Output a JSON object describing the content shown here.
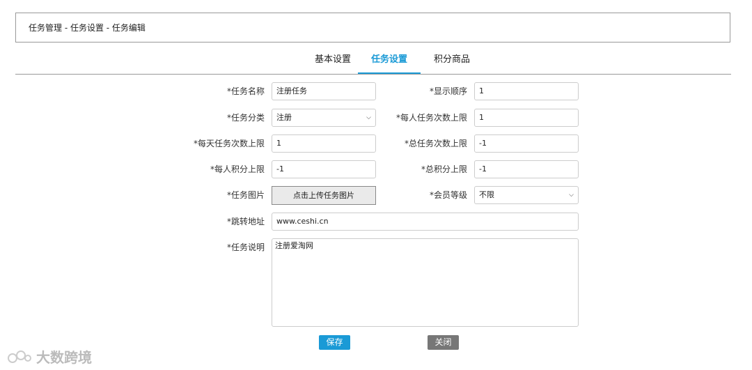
{
  "breadcrumb": "任务管理 - 任务设置 - 任务编辑",
  "tabs": [
    "基本设置",
    "任务设置",
    "积分商品"
  ],
  "active_tab": 1,
  "accent_color": "#1a9ad6",
  "form": {
    "task_name": {
      "label": "*任务名称",
      "value": "注册任务"
    },
    "display_order": {
      "label": "*显示顺序",
      "value": "1"
    },
    "task_category": {
      "label": "*任务分类",
      "value": "注册"
    },
    "per_person_limit": {
      "label": "*每人任务次数上限",
      "value": "1"
    },
    "daily_limit": {
      "label": "*每天任务次数上限",
      "value": "1"
    },
    "total_limit": {
      "label": "*总任务次数上限",
      "value": "-1"
    },
    "per_person_points": {
      "label": "*每人积分上限",
      "value": "-1"
    },
    "total_points": {
      "label": "*总积分上限",
      "value": "-1"
    },
    "task_image": {
      "label": "*任务图片",
      "button": "点击上传任务图片"
    },
    "member_level": {
      "label": "*会员等级",
      "value": "不限"
    },
    "redirect_url": {
      "label": "*跳转地址",
      "value": "www.ceshi.cn"
    },
    "description": {
      "label": "*任务说明",
      "value": "注册爱淘网"
    }
  },
  "buttons": {
    "save": "保存",
    "close": "关闭"
  },
  "watermark": "大数跨境"
}
